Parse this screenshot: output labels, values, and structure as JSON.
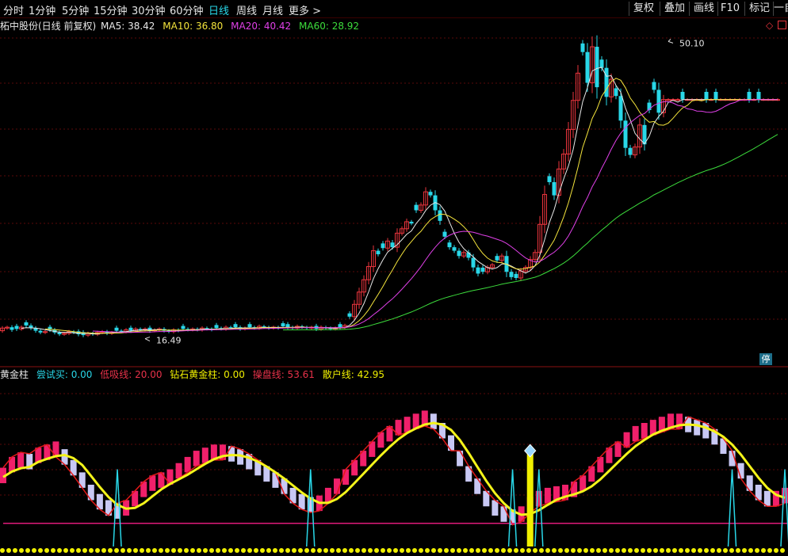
{
  "toolbar": {
    "periods": [
      "分时",
      "1分钟",
      "5分钟",
      "15分钟",
      "30分钟",
      "60分钟",
      "日线",
      "周线",
      "月线",
      "更多 >"
    ],
    "active_period": "日线",
    "buttons": [
      "复权",
      "叠加",
      "画线",
      "F10",
      "标记",
      "一自"
    ]
  },
  "main_info": {
    "stock": "柘中股份(日线 前复权)",
    "ma5": {
      "label": "MA5: 38.42",
      "color": "#e8e8e8"
    },
    "ma10": {
      "label": "MA10: 36.80",
      "color": "#f4e43c"
    },
    "ma20": {
      "label": "MA20: 40.42",
      "color": "#e040e8"
    },
    "ma60": {
      "label": "MA60: 28.92",
      "color": "#3cdc3c"
    }
  },
  "annotations": {
    "high": "50.10",
    "low": "16.49",
    "halt_badge": "停"
  },
  "indicator_info": {
    "name": "黄金柱",
    "items": [
      {
        "label": "尝试买: 0.00",
        "color": "#29d7e8"
      },
      {
        "label": "低吸线: 20.00",
        "color": "#e8324a"
      },
      {
        "label": "钻石黄金柱: 0.00",
        "color": "#f0f000"
      },
      {
        "label": "操盘线: 53.61",
        "color": "#e8324a"
      },
      {
        "label": "散户线: 42.95",
        "color": "#f0f000"
      }
    ]
  },
  "colors": {
    "up": "#e8343c",
    "down": "#29d7e8",
    "grid": "#5a0a0a",
    "ma5": "#e8e8e8",
    "ma10": "#f4e43c",
    "ma20": "#e040e8",
    "ma60": "#3cdc3c",
    "pink_bar": "#f0206a",
    "lavender_bar": "#c8c8f4",
    "base_dots": "#f0f000",
    "red_line": "#e01818",
    "yellow_line": "#f4f41a",
    "cyan_spike": "#29d7e8",
    "ref_line": "#e01a7a"
  }
}
